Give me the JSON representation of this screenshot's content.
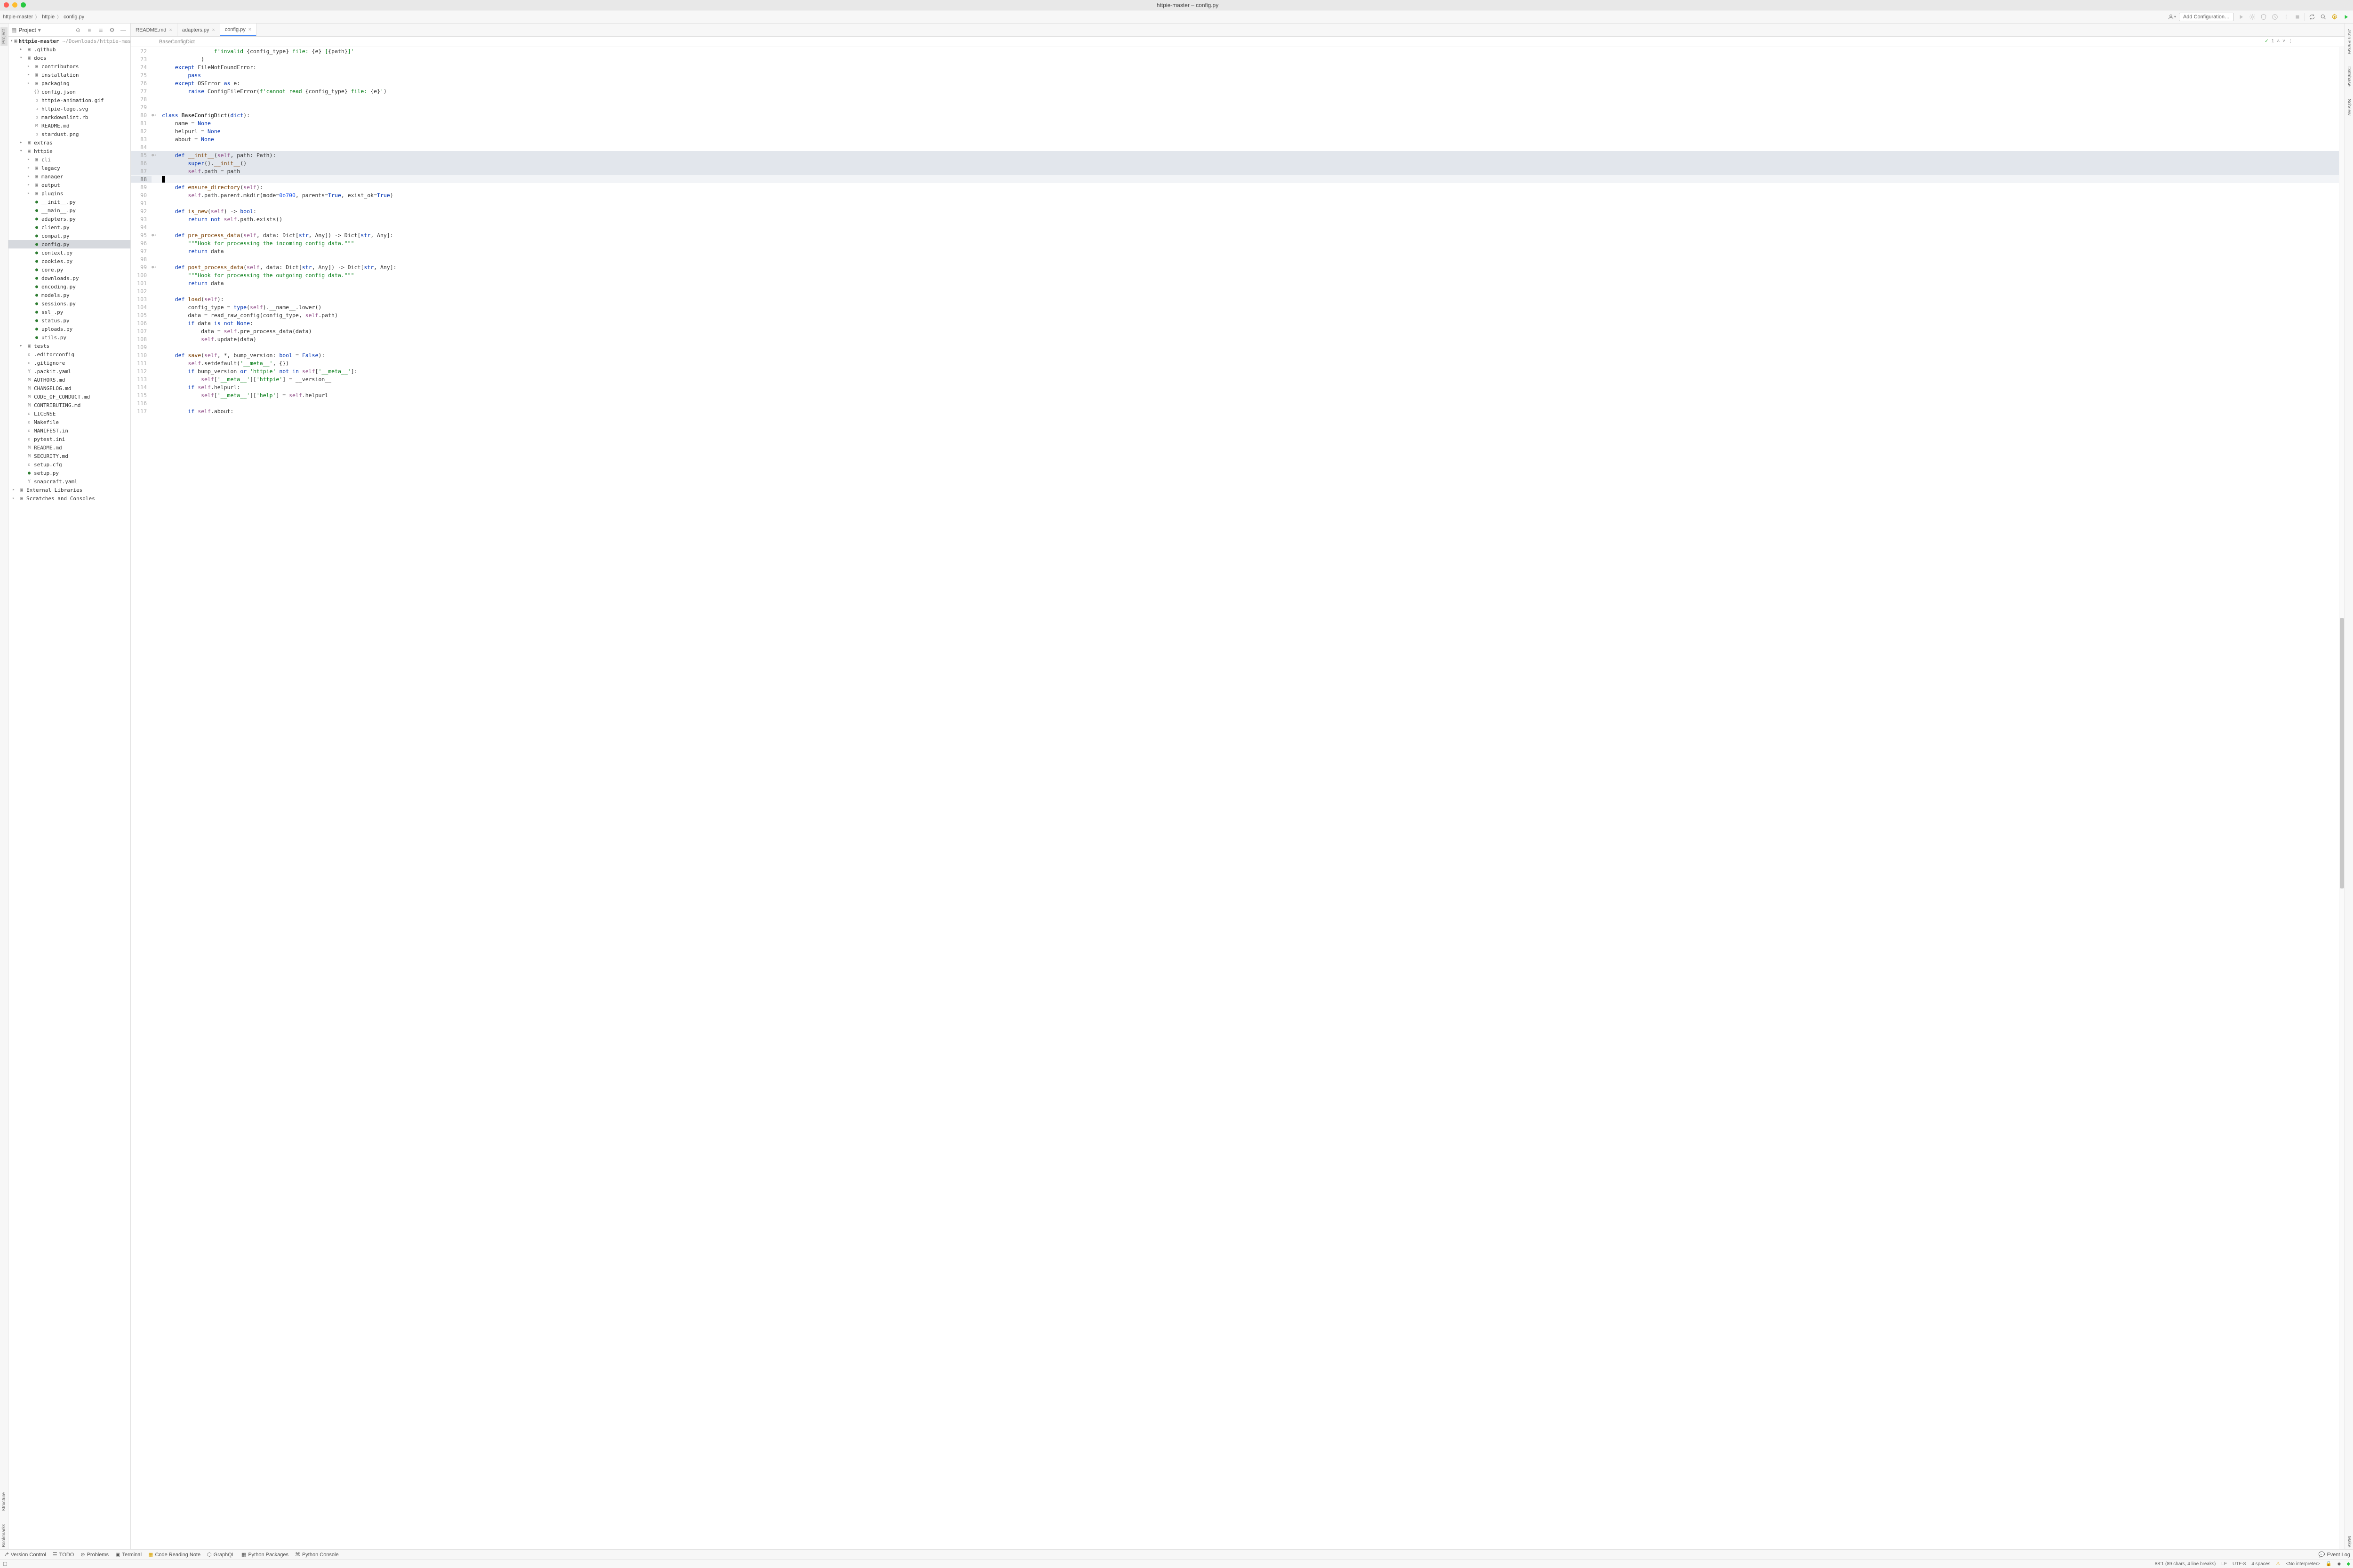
{
  "window_title": "httpie-master – config.py",
  "breadcrumbs": [
    "httpie-master",
    "httpie",
    "config.py"
  ],
  "toolbar": {
    "add_config": "Add Configuration…"
  },
  "project_panel": {
    "title": "Project"
  },
  "tree": {
    "root_name": "httpie-master",
    "root_path": "~/Downloads/httpie-master",
    "items": [
      {
        "d": 1,
        "t": "folder",
        "n": ".github",
        "exp": false,
        "twisty": true
      },
      {
        "d": 1,
        "t": "folder",
        "n": "docs",
        "exp": true,
        "twisty": true
      },
      {
        "d": 2,
        "t": "folder",
        "n": "contributors",
        "twisty": true
      },
      {
        "d": 2,
        "t": "folder",
        "n": "installation",
        "twisty": true
      },
      {
        "d": 2,
        "t": "folder",
        "n": "packaging",
        "twisty": true
      },
      {
        "d": 2,
        "t": "json",
        "n": "config.json"
      },
      {
        "d": 2,
        "t": "file",
        "n": "httpie-animation.gif"
      },
      {
        "d": 2,
        "t": "file",
        "n": "httpie-logo.svg"
      },
      {
        "d": 2,
        "t": "file",
        "n": "markdownlint.rb"
      },
      {
        "d": 2,
        "t": "md",
        "n": "README.md"
      },
      {
        "d": 2,
        "t": "file",
        "n": "stardust.png"
      },
      {
        "d": 1,
        "t": "folder",
        "n": "extras",
        "twisty": true
      },
      {
        "d": 1,
        "t": "folder",
        "n": "httpie",
        "exp": true,
        "twisty": true
      },
      {
        "d": 2,
        "t": "folder",
        "n": "cli",
        "twisty": true
      },
      {
        "d": 2,
        "t": "folder",
        "n": "legacy",
        "twisty": true
      },
      {
        "d": 2,
        "t": "folder",
        "n": "manager",
        "twisty": true
      },
      {
        "d": 2,
        "t": "folder",
        "n": "output",
        "twisty": true
      },
      {
        "d": 2,
        "t": "folder",
        "n": "plugins",
        "twisty": true
      },
      {
        "d": 2,
        "t": "py",
        "n": "__init__.py"
      },
      {
        "d": 2,
        "t": "py",
        "n": "__main__.py"
      },
      {
        "d": 2,
        "t": "py",
        "n": "adapters.py"
      },
      {
        "d": 2,
        "t": "py",
        "n": "client.py"
      },
      {
        "d": 2,
        "t": "py",
        "n": "compat.py"
      },
      {
        "d": 2,
        "t": "py",
        "n": "config.py",
        "sel": true
      },
      {
        "d": 2,
        "t": "py",
        "n": "context.py"
      },
      {
        "d": 2,
        "t": "py",
        "n": "cookies.py"
      },
      {
        "d": 2,
        "t": "py",
        "n": "core.py"
      },
      {
        "d": 2,
        "t": "py",
        "n": "downloads.py"
      },
      {
        "d": 2,
        "t": "py",
        "n": "encoding.py"
      },
      {
        "d": 2,
        "t": "py",
        "n": "models.py"
      },
      {
        "d": 2,
        "t": "py",
        "n": "sessions.py"
      },
      {
        "d": 2,
        "t": "py",
        "n": "ssl_.py"
      },
      {
        "d": 2,
        "t": "py",
        "n": "status.py"
      },
      {
        "d": 2,
        "t": "py",
        "n": "uploads.py"
      },
      {
        "d": 2,
        "t": "py",
        "n": "utils.py"
      },
      {
        "d": 1,
        "t": "folder",
        "n": "tests",
        "twisty": true
      },
      {
        "d": 1,
        "t": "file",
        "n": ".editorconfig"
      },
      {
        "d": 1,
        "t": "file",
        "n": ".gitignore"
      },
      {
        "d": 1,
        "t": "yaml",
        "n": ".packit.yaml"
      },
      {
        "d": 1,
        "t": "md",
        "n": "AUTHORS.md"
      },
      {
        "d": 1,
        "t": "md",
        "n": "CHANGELOG.md"
      },
      {
        "d": 1,
        "t": "md",
        "n": "CODE_OF_CONDUCT.md"
      },
      {
        "d": 1,
        "t": "md",
        "n": "CONTRIBUTING.md"
      },
      {
        "d": 1,
        "t": "file",
        "n": "LICENSE"
      },
      {
        "d": 1,
        "t": "file",
        "n": "Makefile"
      },
      {
        "d": 1,
        "t": "file",
        "n": "MANIFEST.in"
      },
      {
        "d": 1,
        "t": "file",
        "n": "pytest.ini"
      },
      {
        "d": 1,
        "t": "md",
        "n": "README.md"
      },
      {
        "d": 1,
        "t": "md",
        "n": "SECURITY.md"
      },
      {
        "d": 1,
        "t": "file",
        "n": "setup.cfg"
      },
      {
        "d": 1,
        "t": "py",
        "n": "setup.py"
      },
      {
        "d": 1,
        "t": "yaml",
        "n": "snapcraft.yaml"
      },
      {
        "d": 0,
        "t": "lib",
        "n": "External Libraries",
        "twisty": true
      },
      {
        "d": 0,
        "t": "scratch",
        "n": "Scratches and Consoles",
        "twisty": true
      }
    ]
  },
  "tabs": [
    {
      "label": "README.md",
      "active": false
    },
    {
      "label": "adapters.py",
      "active": false
    },
    {
      "label": "config.py",
      "active": true
    }
  ],
  "editor_breadcrumb": "BaseConfigDict",
  "inspection": {
    "status": "✓",
    "count": "1"
  },
  "code_lines": [
    {
      "n": 72,
      "html": "                <span class='str'>f'invalid </span><span class='op'>{</span>config_type<span class='op'>}</span><span class='str'> file: </span><span class='op'>{</span>e<span class='op'>}</span><span class='str'> [</span><span class='op'>{</span>path<span class='op'>}</span><span class='str'>]'</span>"
    },
    {
      "n": 73,
      "html": "            )"
    },
    {
      "n": 74,
      "html": "    <span class='kw'>except</span> FileNotFoundError:"
    },
    {
      "n": 75,
      "html": "        <span class='kw'>pass</span>"
    },
    {
      "n": 76,
      "html": "    <span class='kw'>except</span> OSError <span class='kw'>as</span> e:"
    },
    {
      "n": 77,
      "html": "        <span class='kw'>raise</span> ConfigFileError(<span class='str'>f'cannot read </span><span class='op'>{</span>config_type<span class='op'>}</span><span class='str'> file: </span><span class='op'>{</span>e<span class='op'>}</span><span class='str'>'</span>)"
    },
    {
      "n": 78,
      "html": ""
    },
    {
      "n": 79,
      "html": ""
    },
    {
      "n": 80,
      "mark": "●↓",
      "html": "<span class='kw'>class</span> <span class='cls'>BaseConfigDict</span>(<span class='builtin'>dict</span>):"
    },
    {
      "n": 81,
      "html": "    name = <span class='kw'>None</span>"
    },
    {
      "n": 82,
      "html": "    helpurl = <span class='kw'>None</span>"
    },
    {
      "n": 83,
      "html": "    about = <span class='kw'>None</span>"
    },
    {
      "n": 84,
      "html": ""
    },
    {
      "n": 85,
      "mark": "●↓",
      "sel": true,
      "html": "    <span class='kw'>def</span> <span class='fn'>__init__</span>(<span class='self'>self</span>, path: Path):"
    },
    {
      "n": 86,
      "sel": true,
      "html": "        <span class='builtin'>super</span>().<span class='fn'>__init__</span>()"
    },
    {
      "n": 87,
      "sel": true,
      "html": "        <span class='self'>self</span>.path = path"
    },
    {
      "n": 88,
      "sel": true,
      "caret": true,
      "html": ""
    },
    {
      "n": 89,
      "html": "    <span class='kw'>def</span> <span class='fn'>ensure_directory</span>(<span class='self'>self</span>):"
    },
    {
      "n": 90,
      "html": "        <span class='self'>self</span>.path.parent.mkdir(mode=<span class='num'>0o700</span>, parents=<span class='kw'>True</span>, exist_ok=<span class='kw'>True</span>)"
    },
    {
      "n": 91,
      "html": ""
    },
    {
      "n": 92,
      "html": "    <span class='kw'>def</span> <span class='fn'>is_new</span>(<span class='self'>self</span>) -> <span class='builtin'>bool</span>:"
    },
    {
      "n": 93,
      "html": "        <span class='kw'>return</span> <span class='kw'>not</span> <span class='self'>self</span>.path.exists()"
    },
    {
      "n": 94,
      "html": ""
    },
    {
      "n": 95,
      "mark": "●↓",
      "html": "    <span class='kw'>def</span> <span class='fn'>pre_process_data</span>(<span class='self'>self</span>, data: Dict[<span class='builtin'>str</span>, Any]) -> Dict[<span class='builtin'>str</span>, Any]:"
    },
    {
      "n": 96,
      "html": "        <span class='str'>\"\"\"Hook for processing the incoming config data.\"\"\"</span>"
    },
    {
      "n": 97,
      "html": "        <span class='kw'>return</span> data"
    },
    {
      "n": 98,
      "html": ""
    },
    {
      "n": 99,
      "mark": "●↓",
      "html": "    <span class='kw'>def</span> <span class='fn'>post_process_data</span>(<span class='self'>self</span>, data: Dict[<span class='builtin'>str</span>, Any]) -> Dict[<span class='builtin'>str</span>, Any]:"
    },
    {
      "n": 100,
      "html": "        <span class='str'>\"\"\"Hook for processing the outgoing config data.\"\"\"</span>"
    },
    {
      "n": 101,
      "html": "        <span class='kw'>return</span> data"
    },
    {
      "n": 102,
      "html": ""
    },
    {
      "n": 103,
      "html": "    <span class='kw'>def</span> <span class='fn'>load</span>(<span class='self'>self</span>):"
    },
    {
      "n": 104,
      "html": "        config_type = <span class='builtin'>type</span>(<span class='self'>self</span>).__name__.lower()"
    },
    {
      "n": 105,
      "html": "        data = read_raw_config(config_type, <span class='self'>self</span>.path)"
    },
    {
      "n": 106,
      "html": "        <span class='kw'>if</span> data <span class='kw'>is</span> <span class='kw'>not</span> <span class='kw'>None</span>:"
    },
    {
      "n": 107,
      "html": "            data = <span class='self'>self</span>.pre_process_data(data)"
    },
    {
      "n": 108,
      "html": "            <span class='self'>self</span>.update(data)"
    },
    {
      "n": 109,
      "html": ""
    },
    {
      "n": 110,
      "html": "    <span class='kw'>def</span> <span class='fn'>save</span>(<span class='self'>self</span>, *, bump_version: <span class='builtin'>bool</span> = <span class='kw'>False</span>):"
    },
    {
      "n": 111,
      "html": "        <span class='self'>self</span>.setdefault(<span class='str'>'__meta__'</span>, {})"
    },
    {
      "n": 112,
      "html": "        <span class='kw'>if</span> bump_version <span class='kw'>or</span> <span class='str'>'httpie'</span> <span class='kw'>not</span> <span class='kw'>in</span> <span class='self'>self</span>[<span class='str'>'__meta__'</span>]:"
    },
    {
      "n": 113,
      "html": "            <span class='self'>self</span>[<span class='str'>'__meta__'</span>][<span class='str'>'httpie'</span>] = __version__"
    },
    {
      "n": 114,
      "html": "        <span class='kw'>if</span> <span class='self'>self</span>.helpurl:"
    },
    {
      "n": 115,
      "html": "            <span class='self'>self</span>[<span class='str'>'__meta__'</span>][<span class='str'>'help'</span>] = <span class='self'>self</span>.helpurl"
    },
    {
      "n": 116,
      "html": ""
    },
    {
      "n": 117,
      "html": "        <span class='kw'>if</span> <span class='self'>self</span>.about:"
    }
  ],
  "leftstrip": [
    "Project"
  ],
  "leftstrip2": [
    "Structure",
    "Bookmarks"
  ],
  "rightstrip": [
    "Json Parser",
    "Database",
    "SciView"
  ],
  "rightstrip2": [
    "Make"
  ],
  "bottombar": {
    "items": [
      "Version Control",
      "TODO",
      "Problems",
      "Terminal",
      "Code Reading Note",
      "GraphQL",
      "Python Packages",
      "Python Console"
    ],
    "event_log": "Event Log"
  },
  "statusbar": {
    "position": "88:1 (89 chars, 4 line breaks)",
    "line_sep": "LF",
    "encoding": "UTF-8",
    "indent": "4 spaces",
    "interpreter": "<No interpreter>"
  }
}
